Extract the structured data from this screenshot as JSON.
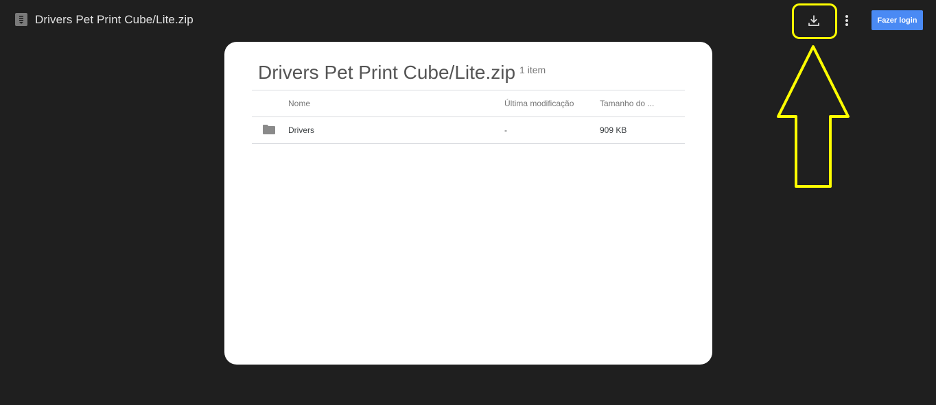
{
  "header": {
    "file_title": "Drivers Pet Print Cube/Lite.zip",
    "icons": {
      "file_type": "zip-file-icon",
      "download": "download-icon",
      "more": "more-vert-icon"
    },
    "login_label": "Fazer login"
  },
  "card": {
    "title": "Drivers Pet Print Cube/Lite.zip",
    "item_count": "1 item",
    "columns": {
      "name": "Nome",
      "modified": "Última modificação",
      "size": "Tamanho do ..."
    },
    "rows": [
      {
        "icon": "folder-icon",
        "name": "Drivers",
        "modified": "-",
        "size": "909 KB"
      }
    ]
  },
  "annotation": {
    "color": "#ffff00",
    "target": "download-icon"
  },
  "colors": {
    "background": "#1f1f1f",
    "card": "#ffffff",
    "login_button": "#4a8af4"
  }
}
